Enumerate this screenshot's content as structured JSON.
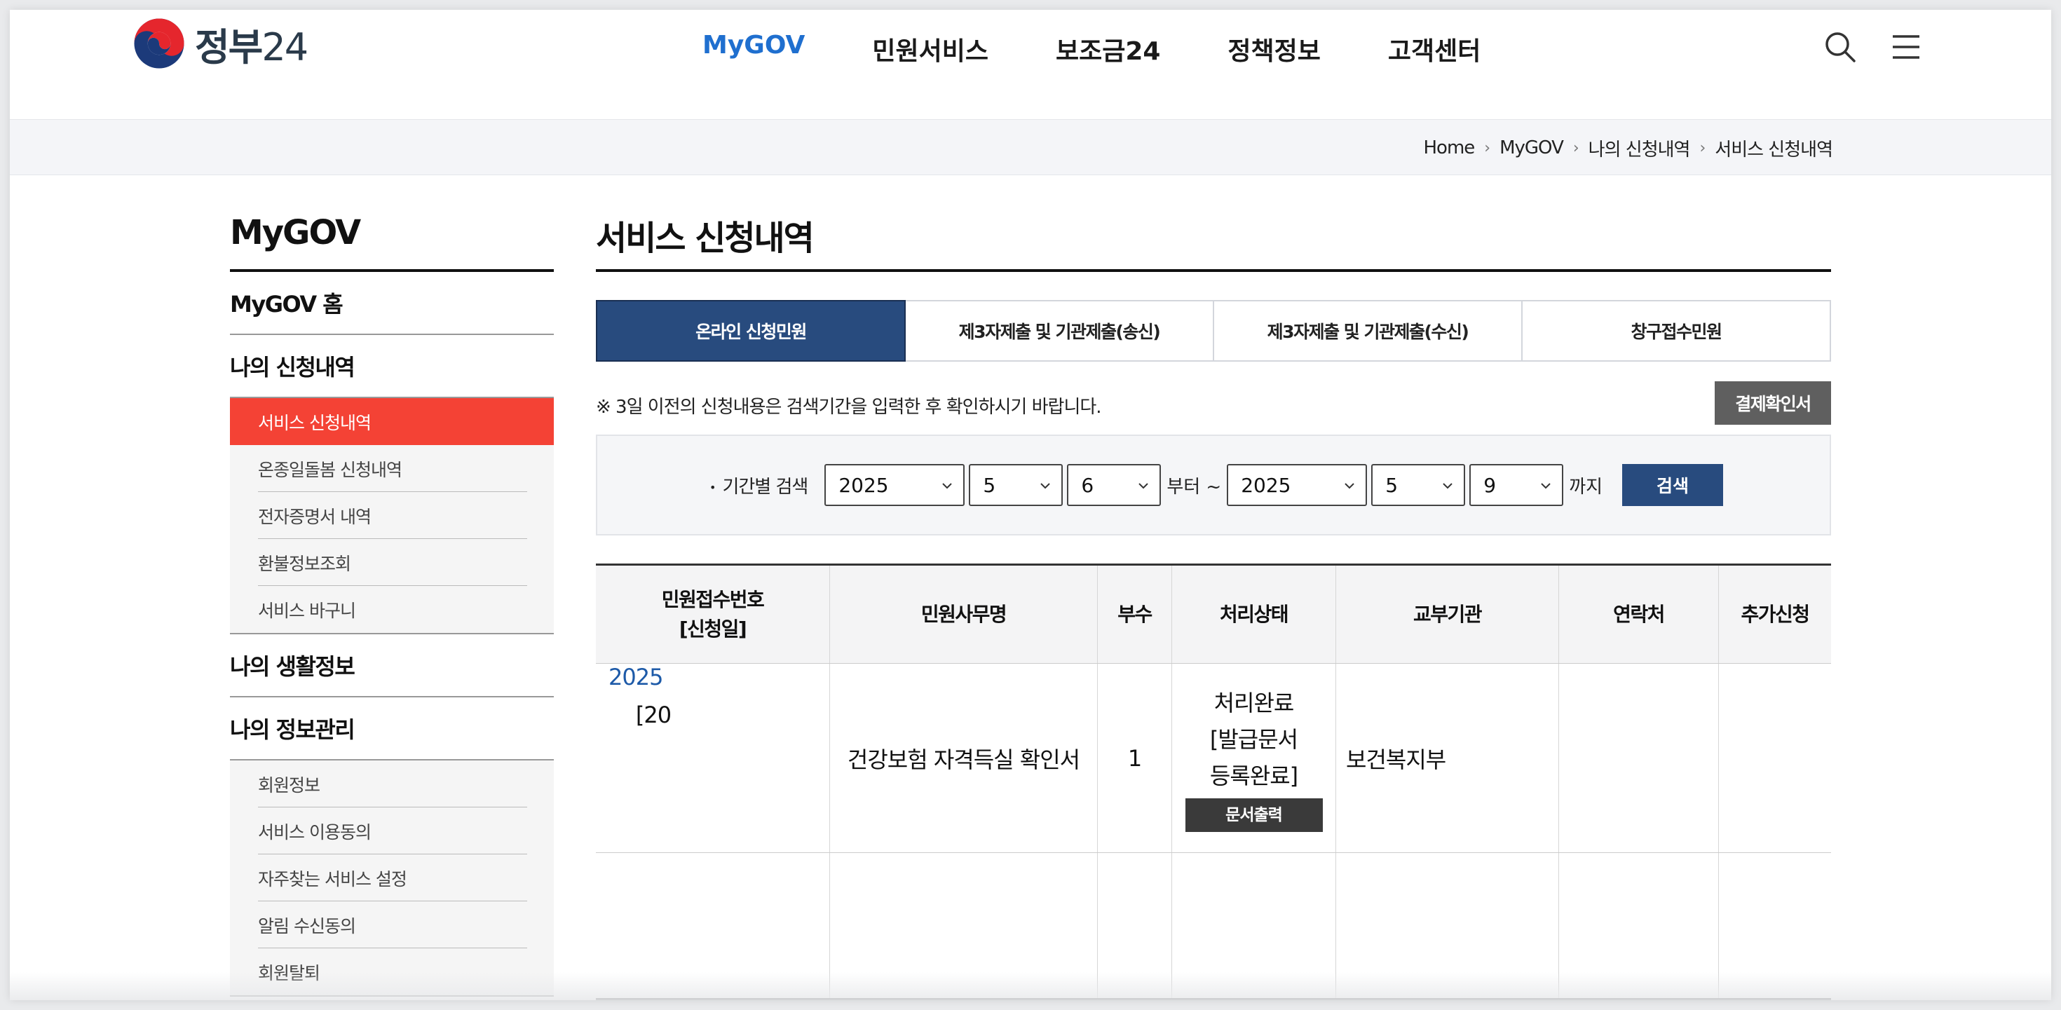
{
  "header": {
    "logo_text": "정부",
    "logo_num": "24",
    "nav": [
      {
        "label": "MyGOV"
      },
      {
        "label": "민원서비스"
      },
      {
        "label": "보조금24"
      },
      {
        "label": "정책정보"
      },
      {
        "label": "고객센터"
      }
    ],
    "active_nav": "MyGOV",
    "icons": [
      "search-icon",
      "menu-icon"
    ]
  },
  "breadcrumb": [
    "Home",
    "MyGOV",
    "나의 신청내역",
    "서비스 신청내역"
  ],
  "sidebar": {
    "title": "MyGOV",
    "home": "MyGOV 홈",
    "cat_apply": "나의 신청내역",
    "apply_items": [
      {
        "label": "서비스 신청내역"
      },
      {
        "label": "온종일돌봄 신청내역"
      },
      {
        "label": "전자증명서 내역"
      },
      {
        "label": "환불정보조회"
      },
      {
        "label": "서비스 바구니"
      }
    ],
    "cat_life": "나의 생활정보",
    "cat_info": "나의 정보관리",
    "info_items": [
      {
        "label": "회원정보"
      },
      {
        "label": "서비스 이용동의"
      },
      {
        "label": "자주찾는 서비스 설정"
      },
      {
        "label": "알림 수신동의"
      },
      {
        "label": "회원탈퇴"
      }
    ]
  },
  "main": {
    "title": "서비스 신청내역",
    "tabs": [
      {
        "label": "온라인 신청민원"
      },
      {
        "label": "제3자제출 및 기관제출(송신)"
      },
      {
        "label": "제3자제출 및 기관제출(수신)"
      },
      {
        "label": "창구접수민원"
      }
    ],
    "notice": "※ 3일 이전의 신청내용은 검색기간을 입력한 후 확인하시기 바랍니다.",
    "receipt_button": "결제확인서",
    "search": {
      "label": "기간별 검색",
      "from_year": "2025",
      "from_month": "5",
      "from_day": "6",
      "from_suffix": "부터 ~",
      "to_year": "2025",
      "to_month": "5",
      "to_day": "9",
      "to_suffix": "까지",
      "button": "검색"
    },
    "table": {
      "headers": {
        "receipt_line1": "민원접수번호",
        "receipt_line2": "[신청일]",
        "name": "민원사무명",
        "copies": "부수",
        "status": "처리상태",
        "agency": "교부기관",
        "contact": "연락처",
        "extra": "추가신청"
      },
      "rows": [
        {
          "receipt_no": "2025",
          "date": "[20",
          "name": "건강보험 자격득실 확인서",
          "copies": "1",
          "status_line1": "처리완료",
          "status_line2": "[발급문서",
          "status_line3": "등록완료]",
          "print_button": "문서출력",
          "agency": "보건복지부",
          "contact": "",
          "extra": ""
        }
      ]
    }
  },
  "colors": {
    "accent_blue": "#1f6fcf",
    "navy": "#284b7e",
    "active_red": "#f44235",
    "dark_button": "#5f5f5f"
  }
}
